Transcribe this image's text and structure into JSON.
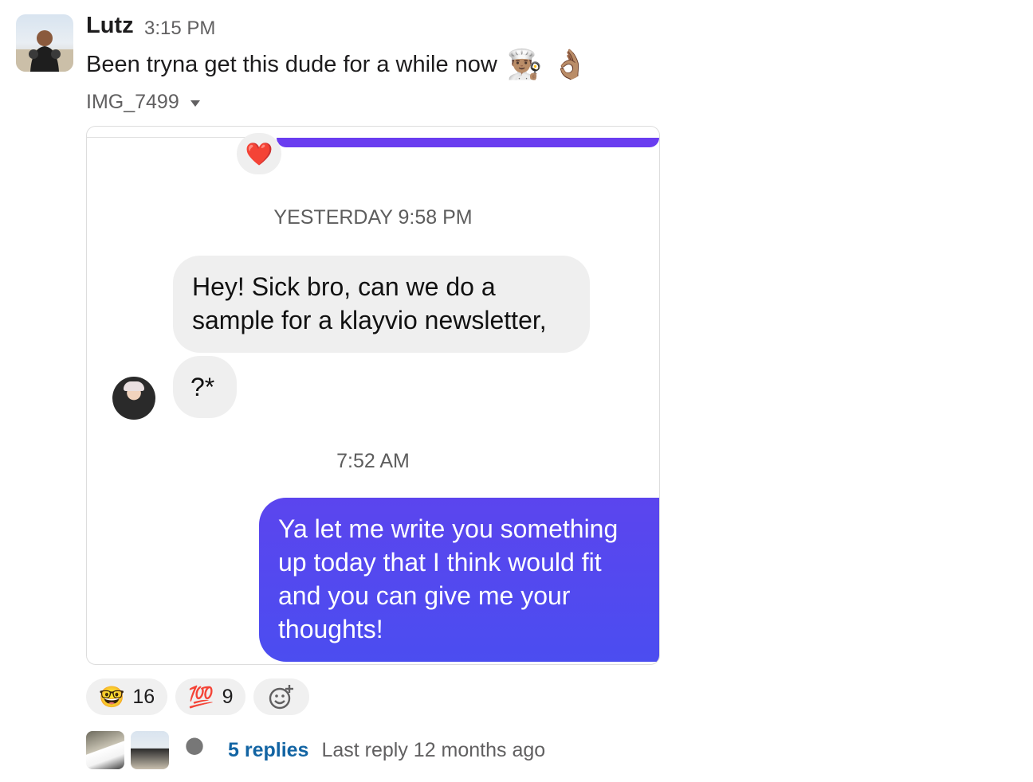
{
  "message": {
    "sender": "Lutz",
    "timestamp": "3:15 PM",
    "text": "Been tryna get this dude for a while now",
    "emojis": [
      "👨🏽‍🍳",
      "👌🏽"
    ]
  },
  "attachment": {
    "file_name": "IMG_7499"
  },
  "screenshot": {
    "reaction_emoji": "❤️",
    "stamp_1": "YESTERDAY 9:58 PM",
    "received_1": "Hey! Sick bro, can we do a sample for a klayvio newsletter,",
    "received_2": "?*",
    "stamp_2": "7:52 AM",
    "sent_1": "Ya let me write you something up today that I think would fit and you can give me your thoughts!",
    "sent_color": "#5447ef"
  },
  "reactions": [
    {
      "emoji": "🤓",
      "count": "16",
      "icon": "nerd-face-icon"
    },
    {
      "emoji": "💯",
      "count": "9",
      "icon": "hundred-points-icon"
    }
  ],
  "add_reaction_icon": "add-emoji-icon",
  "thread": {
    "replies": "5 replies",
    "last_reply": "Last reply 12 months ago"
  }
}
